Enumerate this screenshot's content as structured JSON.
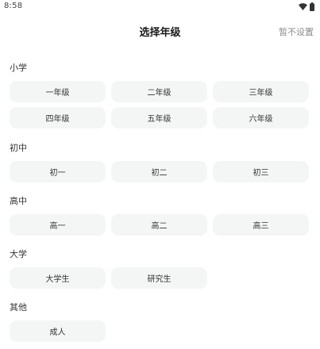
{
  "status_bar": {
    "time": "8:58",
    "icons": [
      "wifi-icon",
      "battery-icon"
    ]
  },
  "header": {
    "title": "选择年级",
    "skip_label": "暂不设置"
  },
  "sections": [
    {
      "title": "小学",
      "options": [
        "一年级",
        "二年级",
        "三年级",
        "四年级",
        "五年级",
        "六年级"
      ]
    },
    {
      "title": "初中",
      "options": [
        "初一",
        "初二",
        "初三"
      ]
    },
    {
      "title": "高中",
      "options": [
        "高一",
        "高二",
        "高三"
      ]
    },
    {
      "title": "大学",
      "options": [
        "大学生",
        "研究生"
      ]
    },
    {
      "title": "其他",
      "options": [
        "成人"
      ]
    }
  ],
  "colors": {
    "background": "#ffffff",
    "option_background": "#f4f5f5",
    "skip_text": "#8c8c8c"
  }
}
